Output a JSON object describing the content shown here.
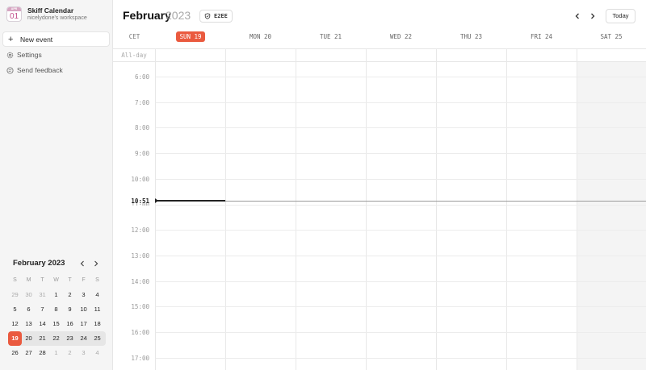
{
  "app": {
    "icon_month": "APR",
    "icon_day": "01",
    "workspace_title": "Skiff Calendar",
    "workspace_subtitle": "nicelydone's workspace"
  },
  "sidebar": {
    "new_event_label": "New event",
    "settings_label": "Settings",
    "feedback_label": "Send feedback"
  },
  "mini_calendar": {
    "title": "February 2023",
    "weekdays": [
      "S",
      "M",
      "T",
      "W",
      "T",
      "F",
      "S"
    ],
    "weeks": [
      [
        "29",
        "30",
        "31",
        "1",
        "2",
        "3",
        "4"
      ],
      [
        "5",
        "6",
        "7",
        "8",
        "9",
        "10",
        "11"
      ],
      [
        "12",
        "13",
        "14",
        "15",
        "16",
        "17",
        "18"
      ],
      [
        "19",
        "20",
        "21",
        "22",
        "23",
        "24",
        "25"
      ],
      [
        "26",
        "27",
        "28",
        "1",
        "2",
        "3",
        "4"
      ]
    ]
  },
  "header": {
    "month": "February",
    "year": "2023",
    "badge": "E2EE",
    "today_label": "Today"
  },
  "grid": {
    "timezone": "CET",
    "all_day_label": "All-day",
    "days": [
      "SUN 19",
      "MON 20",
      "TUE 21",
      "WED 22",
      "THU 23",
      "FRI 24",
      "SAT 25"
    ],
    "hours": [
      "6:00",
      "7:00",
      "8:00",
      "9:00",
      "10:00",
      "11:00",
      "12:00",
      "13:00",
      "14:00",
      "15:00",
      "16:00",
      "17:00"
    ],
    "current_time": "10:51"
  },
  "colors": {
    "accent": "#ea5a3f",
    "icon_pink": "#c24e8a"
  }
}
